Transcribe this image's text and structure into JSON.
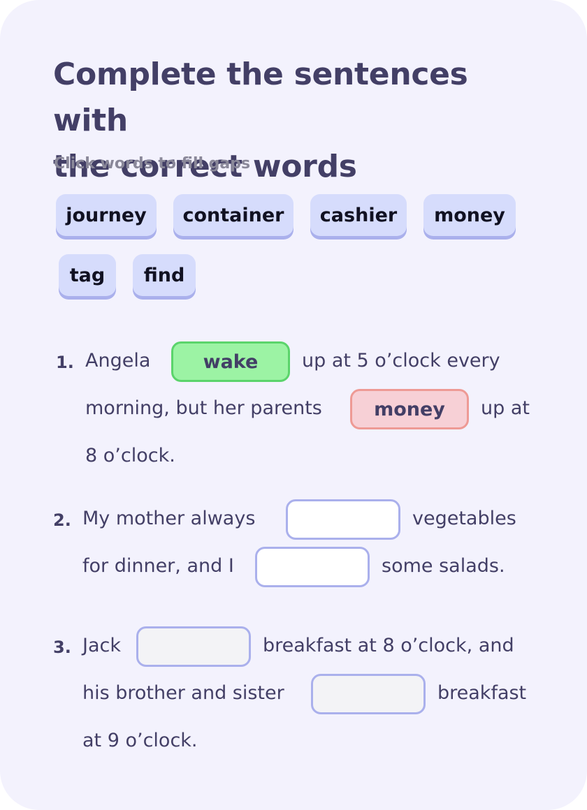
{
  "exercise": {
    "title_line1": "Complete the sentences with",
    "title_line2": "the correct words",
    "subtitle": "Click words to fill gaps"
  },
  "word_bank": [
    "journey",
    "container",
    "cashier",
    "money",
    "tag",
    "find"
  ],
  "sentences": [
    {
      "number": "1.",
      "lines": [
        "Angela",
        "up at 5 o’clock every",
        "morning, but her parents",
        "up at",
        "8 o’clock."
      ],
      "gaps": [
        {
          "value": "wake",
          "state": "correct"
        },
        {
          "value": "money",
          "state": "incorrect"
        }
      ]
    },
    {
      "number": "2.",
      "lines": [
        "My mother always",
        "vegetables",
        "for dinner, and I",
        "some salads."
      ],
      "gaps": [
        {
          "value": "",
          "state": "empty"
        },
        {
          "value": "",
          "state": "empty"
        }
      ]
    },
    {
      "number": "3.",
      "lines": [
        "Jack",
        "breakfast at 8 o’clock, and",
        "his brother and sister",
        "breakfast",
        "at 9 o’clock."
      ],
      "gaps": [
        {
          "value": "",
          "state": "empty"
        },
        {
          "value": "",
          "state": "empty"
        }
      ]
    }
  ],
  "colors": {
    "card_background": "#f3f2fd",
    "text": "#433f66",
    "chip_background": "#d6dcfc",
    "correct_fill": "#9cf3a4",
    "incorrect_fill": "#f7d0d6",
    "gap_border": "#aab0ec"
  }
}
